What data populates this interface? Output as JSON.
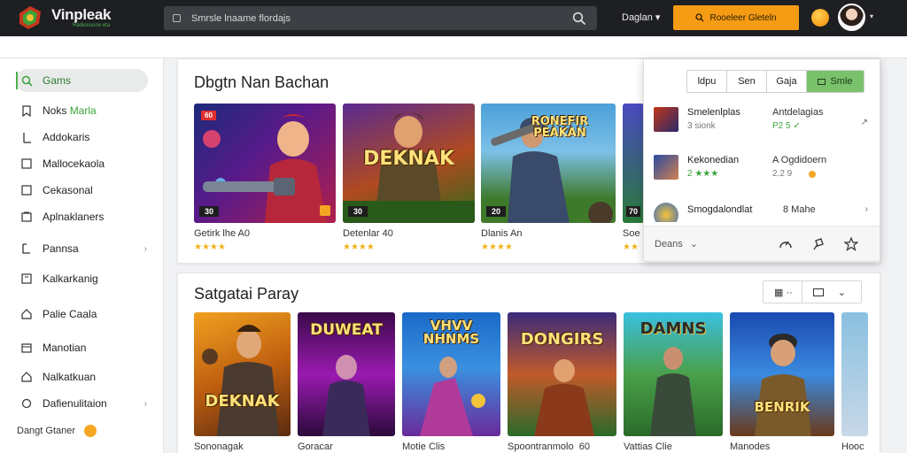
{
  "header": {
    "brand_name": "Vinpleak",
    "brand_tagline": "Radiosoone eta",
    "search_placeholder": "Smrsle lnaame flordajs",
    "language": "Daglan",
    "cta_label": "Rooeleer Gleteln"
  },
  "sidebar": {
    "items": [
      {
        "label": "Gams",
        "icon": "search-icon",
        "active": true
      },
      {
        "label": "Noks",
        "accent": "Marla",
        "icon": "bookmark-icon"
      },
      {
        "label": "Addokaris",
        "icon": "bar-icon"
      },
      {
        "label": "Mallocekaola",
        "icon": "square-icon"
      },
      {
        "label": "Cekasonal",
        "icon": "square-icon"
      },
      {
        "label": "Aplnaklaners",
        "icon": "layers-icon"
      },
      {
        "label": "Pannsa",
        "icon": "bracket-icon",
        "chevron": true
      },
      {
        "label": "Kalkarkanig",
        "icon": "box-icon"
      },
      {
        "label": "Palie Caala",
        "icon": "home-icon"
      },
      {
        "label": "Manotian",
        "icon": "calendar-icon"
      },
      {
        "label": "Nalkatkuan",
        "icon": "house-icon",
        "accent_word": true
      },
      {
        "label": "Dafienulitaion",
        "icon": "circle-icon",
        "chevron": true
      }
    ],
    "footer_label": "Dangt Gtaner"
  },
  "section1": {
    "title": "Dbgtn Nan Bachan",
    "cards": [
      {
        "caption": "Getirk lhe A0",
        "stars": "★★★★",
        "tag": "60",
        "badge": "30"
      },
      {
        "caption": "Detenlar 40",
        "stars": "★★★★",
        "tag": "30",
        "cover_title": "DEKNAK"
      },
      {
        "caption": "Dlanis An",
        "stars": "★★★★",
        "tag": "20",
        "cover_title": "RONEFIR PEAKAN"
      },
      {
        "caption": "Soe",
        "stars": "★★",
        "tag": "70"
      }
    ]
  },
  "popover": {
    "tabs": [
      "ldpu",
      "Sen",
      "Gaja",
      "Smle"
    ],
    "rows": [
      {
        "name": "Smelenlplas",
        "sub": "3 sionk",
        "name2": "Antdelagias",
        "sub2": "P2 5 ✓"
      },
      {
        "name": "Kekonedian",
        "sub": "2 ★★★",
        "name2": "A Ogdidoern",
        "sub2": "2.2 9"
      },
      {
        "name": "Smogdalondlat",
        "sub": "",
        "name2": "8 Mahe",
        "sub2": ""
      }
    ],
    "footer_label": "Deans"
  },
  "section2": {
    "title": "Satgatai Paray",
    "cards": [
      {
        "caption": "Sononagak",
        "cover_title": "DEKNAK"
      },
      {
        "caption": "Goracar",
        "cover_title": "DUWEAT"
      },
      {
        "caption": "Motie Clis",
        "cover_title": "VHVV NHNMS"
      },
      {
        "caption": "Spoontranmolo",
        "extra": "60",
        "cover_title": "DONGIRS"
      },
      {
        "caption": "Vattias Clie",
        "cover_title": "DAMNS"
      },
      {
        "caption": "Manodes",
        "cover_title": "BENRIK"
      },
      {
        "caption": "Hooc",
        "cover_title": ""
      }
    ]
  },
  "colors": {
    "accent": "#f59b14",
    "active_green": "#4caf50",
    "star": "#f2b21b",
    "topbar": "#1d1f22"
  }
}
